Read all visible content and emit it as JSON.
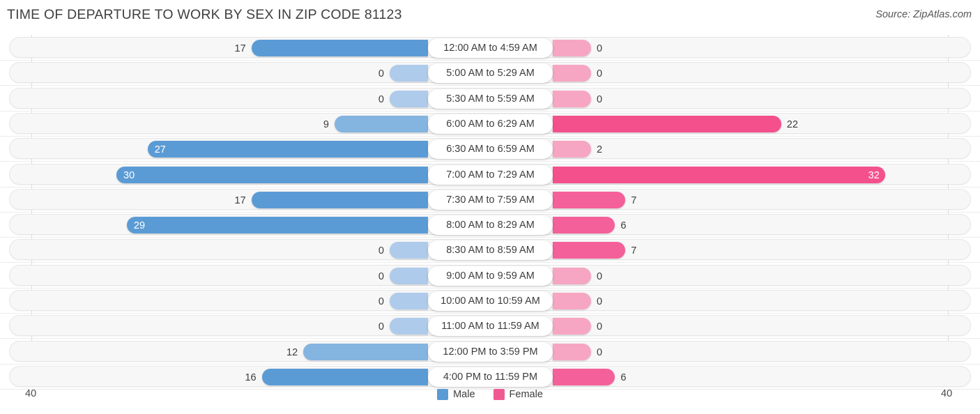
{
  "header": {
    "title": "TIME OF DEPARTURE TO WORK BY SEX IN ZIP CODE 81123",
    "source": "Source: ZipAtlas.com"
  },
  "legend": {
    "male_label": "Male",
    "female_label": "Female",
    "male_color": "#5B9BD5",
    "female_color": "#F05A92"
  },
  "axis": {
    "left_max": "40",
    "right_max": "40"
  },
  "chart_data": {
    "type": "bar",
    "title": "TIME OF DEPARTURE TO WORK BY SEX IN ZIP CODE 81123",
    "orientation": "horizontal-diverging",
    "xlabel": "",
    "ylabel": "",
    "xlim": [
      40,
      40
    ],
    "grid": true,
    "legend_position": "bottom-center",
    "categories": [
      "12:00 AM to 4:59 AM",
      "5:00 AM to 5:29 AM",
      "5:30 AM to 5:59 AM",
      "6:00 AM to 6:29 AM",
      "6:30 AM to 6:59 AM",
      "7:00 AM to 7:29 AM",
      "7:30 AM to 7:59 AM",
      "8:00 AM to 8:29 AM",
      "8:30 AM to 8:59 AM",
      "9:00 AM to 9:59 AM",
      "10:00 AM to 10:59 AM",
      "11:00 AM to 11:59 AM",
      "12:00 PM to 3:59 PM",
      "4:00 PM to 11:59 PM"
    ],
    "series": [
      {
        "name": "Male",
        "values": [
          17,
          0,
          0,
          9,
          27,
          30,
          17,
          29,
          0,
          0,
          0,
          0,
          12,
          16
        ]
      },
      {
        "name": "Female",
        "values": [
          0,
          0,
          0,
          22,
          2,
          32,
          7,
          6,
          7,
          0,
          0,
          0,
          0,
          6
        ]
      }
    ]
  },
  "rows": [
    {
      "label": "12:00 AM to 4:59 AM",
      "male": "17",
      "female": "0",
      "male_inside": false,
      "female_inside": false
    },
    {
      "label": "5:00 AM to 5:29 AM",
      "male": "0",
      "female": "0",
      "male_inside": false,
      "female_inside": false
    },
    {
      "label": "5:30 AM to 5:59 AM",
      "male": "0",
      "female": "0",
      "male_inside": false,
      "female_inside": false
    },
    {
      "label": "6:00 AM to 6:29 AM",
      "male": "9",
      "female": "22",
      "male_inside": false,
      "female_inside": false
    },
    {
      "label": "6:30 AM to 6:59 AM",
      "male": "27",
      "female": "2",
      "male_inside": true,
      "female_inside": false
    },
    {
      "label": "7:00 AM to 7:29 AM",
      "male": "30",
      "female": "32",
      "male_inside": true,
      "female_inside": true
    },
    {
      "label": "7:30 AM to 7:59 AM",
      "male": "17",
      "female": "7",
      "male_inside": false,
      "female_inside": false
    },
    {
      "label": "8:00 AM to 8:29 AM",
      "male": "29",
      "female": "6",
      "male_inside": true,
      "female_inside": false
    },
    {
      "label": "8:30 AM to 8:59 AM",
      "male": "0",
      "female": "7",
      "male_inside": false,
      "female_inside": false
    },
    {
      "label": "9:00 AM to 9:59 AM",
      "male": "0",
      "female": "0",
      "male_inside": false,
      "female_inside": false
    },
    {
      "label": "10:00 AM to 10:59 AM",
      "male": "0",
      "female": "0",
      "male_inside": false,
      "female_inside": false
    },
    {
      "label": "11:00 AM to 11:59 AM",
      "male": "0",
      "female": "0",
      "male_inside": false,
      "female_inside": false
    },
    {
      "label": "12:00 PM to 3:59 PM",
      "male": "12",
      "female": "0",
      "male_inside": false,
      "female_inside": false
    },
    {
      "label": "4:00 PM to 11:59 PM",
      "male": "16",
      "female": "6",
      "male_inside": false,
      "female_inside": false
    }
  ]
}
